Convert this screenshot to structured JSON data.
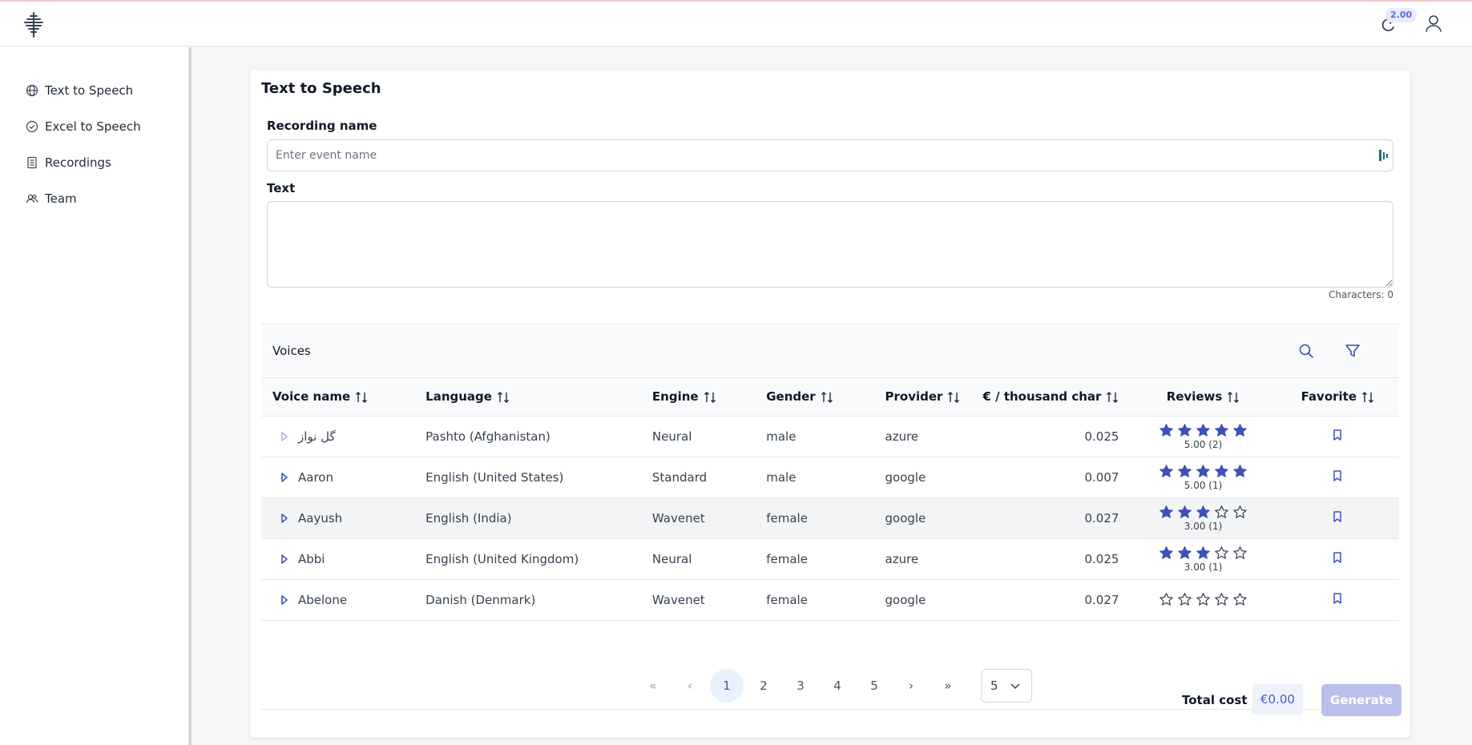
{
  "header": {
    "credits": "2.00"
  },
  "sidebar": {
    "items": [
      {
        "label": "Text to Speech",
        "icon": "globe-icon"
      },
      {
        "label": "Excel to Speech",
        "icon": "check-circle-icon"
      },
      {
        "label": "Recordings",
        "icon": "document-icon"
      },
      {
        "label": "Team",
        "icon": "team-icon"
      }
    ]
  },
  "main": {
    "title": "Text to Speech",
    "recording_label": "Recording name",
    "recording_placeholder": "Enter event name",
    "text_label": "Text",
    "char_count": "Characters: 0",
    "voices": {
      "title": "Voices",
      "columns": [
        "Voice name",
        "Language",
        "Engine",
        "Gender",
        "Provider",
        "€ / thousand char",
        "Reviews",
        "Favorite"
      ],
      "rows": [
        {
          "name": "گل نواز",
          "language": "Pashto (Afghanistan)",
          "engine": "Neural",
          "gender": "male",
          "provider": "azure",
          "price": "0.025",
          "stars": 5,
          "rating": "5.00 (2)"
        },
        {
          "name": "Aaron",
          "language": "English (United States)",
          "engine": "Standard",
          "gender": "male",
          "provider": "google",
          "price": "0.007",
          "stars": 5,
          "rating": "5.00 (1)"
        },
        {
          "name": "Aayush",
          "language": "English (India)",
          "engine": "Wavenet",
          "gender": "female",
          "provider": "google",
          "price": "0.027",
          "stars": 3,
          "rating": "3.00 (1)"
        },
        {
          "name": "Abbi",
          "language": "English (United Kingdom)",
          "engine": "Neural",
          "gender": "female",
          "provider": "azure",
          "price": "0.025",
          "stars": 3,
          "rating": "3.00 (1)"
        },
        {
          "name": "Abelone",
          "language": "Danish (Denmark)",
          "engine": "Wavenet",
          "gender": "female",
          "provider": "google",
          "price": "0.027",
          "stars": 0,
          "rating": ""
        }
      ]
    },
    "pagination": {
      "first": "«",
      "prev": "‹",
      "pages": [
        "1",
        "2",
        "3",
        "4",
        "5"
      ],
      "current": "1",
      "next": "›",
      "last": "»",
      "page_size": "5"
    },
    "total_label": "Total cost",
    "total_value": "€0.00",
    "generate_label": "Generate"
  },
  "colors": {
    "accent": "#3f51b5",
    "generate_disabled": "#b9c0ea"
  }
}
